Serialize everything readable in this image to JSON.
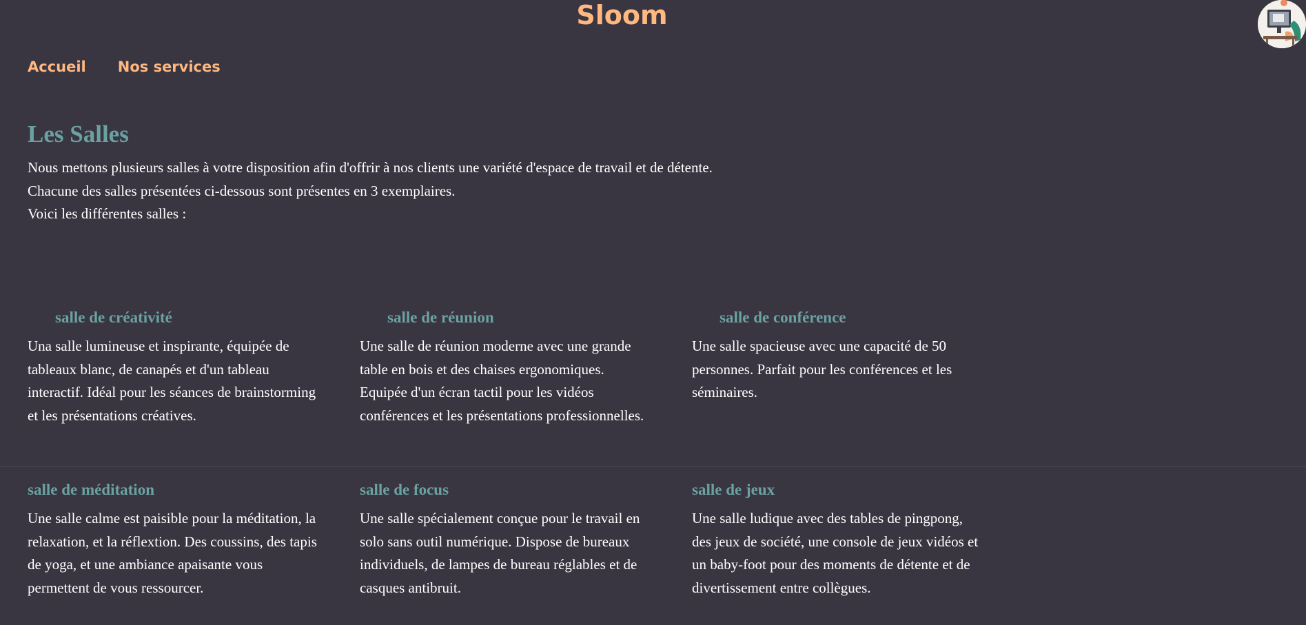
{
  "header": {
    "title": "Sloom",
    "avatar_icon": "user-avatar-illustration"
  },
  "nav": {
    "items": [
      {
        "label": "Accueil"
      },
      {
        "label": "Nos services"
      }
    ]
  },
  "main": {
    "title": "Les Salles",
    "intro": [
      "Nous mettons plusieurs salles à votre disposition afin d'offrir à nos clients une variété d'espace de travail et de détente.",
      "Chacune des salles présentées ci-dessous sont présentes en 3 exemplaires.",
      "Voici les différentes salles :"
    ],
    "rooms": [
      {
        "name": "salle de créativité",
        "description": "Una salle lumineuse et inspirante, équipée de tableaux blanc, de canapés et d'un tableau interactif. Idéal pour les séances de brainstorming et les présentations créatives."
      },
      {
        "name": "salle de réunion",
        "description": "Une salle de réunion moderne avec une grande table en bois et des chaises ergonomiques. Equipée d'un écran tactil pour les vidéos conférences et les présentations professionnelles."
      },
      {
        "name": "salle de conférence",
        "description": "Une salle spacieuse avec une capacité de 50 personnes. Parfait pour les conférences et les séminaires."
      },
      {
        "name": "salle de méditation",
        "description": "Une salle calme est paisible pour la méditation, la relaxation, et la réflextion. Des coussins, des tapis de yoga, et une ambiance apaisante vous permettent de vous ressourcer."
      },
      {
        "name": "salle de focus",
        "description": "Une salle spécialement conçue pour le travail en solo sans outil numérique. Dispose de bureaux individuels, de lampes de bureau réglables et de casques antibruit."
      },
      {
        "name": "salle de jeux",
        "description": "Une salle ludique avec des tables de pingpong, des jeux de société, une console de jeux vidéos et un baby-foot pour des moments de détente et de divertissement entre collègues."
      }
    ]
  },
  "colors": {
    "background": "#393541",
    "accent": "#ffb980",
    "heading": "#6aa2a2",
    "text": "#ffffff"
  }
}
